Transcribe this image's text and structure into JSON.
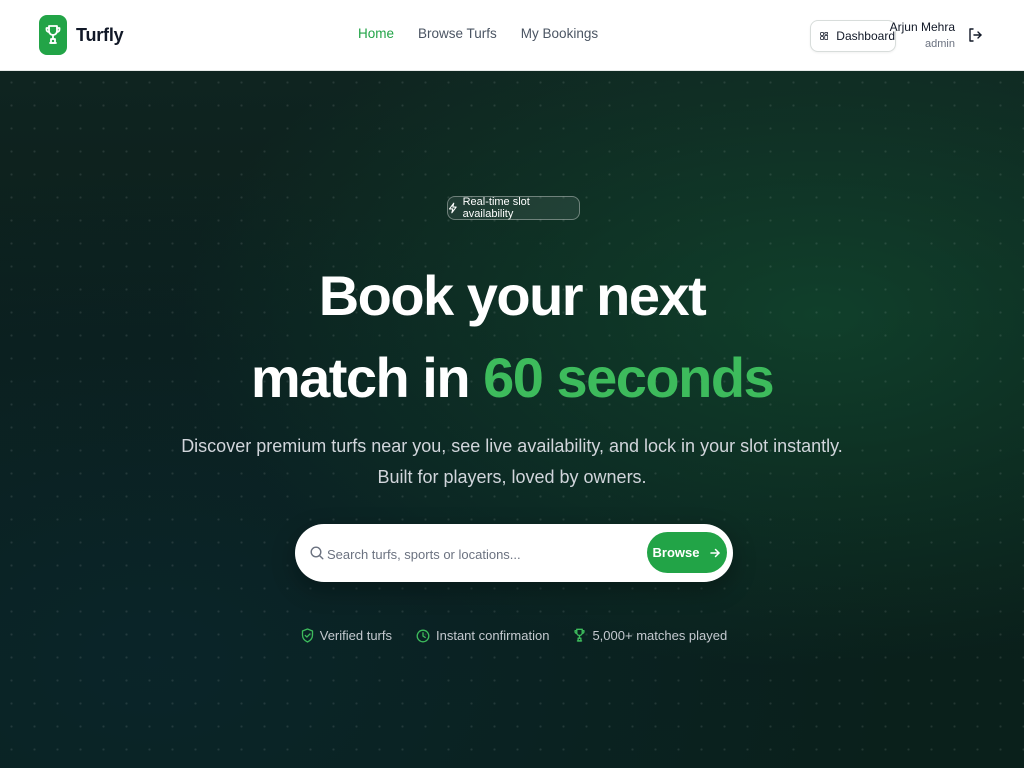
{
  "brand": {
    "name": "Turfly",
    "logo_icon": "trophy-icon",
    "color": "#22a447"
  },
  "nav": {
    "links": [
      {
        "label": "Home",
        "active": true
      },
      {
        "label": "Browse Turfs",
        "active": false
      },
      {
        "label": "My Bookings",
        "active": false
      }
    ]
  },
  "header": {
    "dashboard_label": "Dashboard",
    "user_name": "Arjun Mehra",
    "user_role": "admin"
  },
  "hero": {
    "badge": "Real-time slot availability",
    "headline_line1": "Book your next",
    "headline_line2_prefix": "match in ",
    "headline_line2_accent": "60 seconds",
    "subtitle_line1": "Discover premium turfs near you, see live availability, and lock in your slot instantly.",
    "subtitle_line2": "Built for players, loved by owners.",
    "accent_color": "#3dbb5c"
  },
  "search": {
    "placeholder": "Search turfs, sports or locations...",
    "value": "",
    "button_label": "Browse"
  },
  "features": [
    {
      "label": "Verified turfs",
      "icon": "shield-check-icon"
    },
    {
      "label": "Instant confirmation",
      "icon": "clock-icon"
    },
    {
      "label": "5,000+ matches played",
      "icon": "trophy-icon"
    }
  ]
}
